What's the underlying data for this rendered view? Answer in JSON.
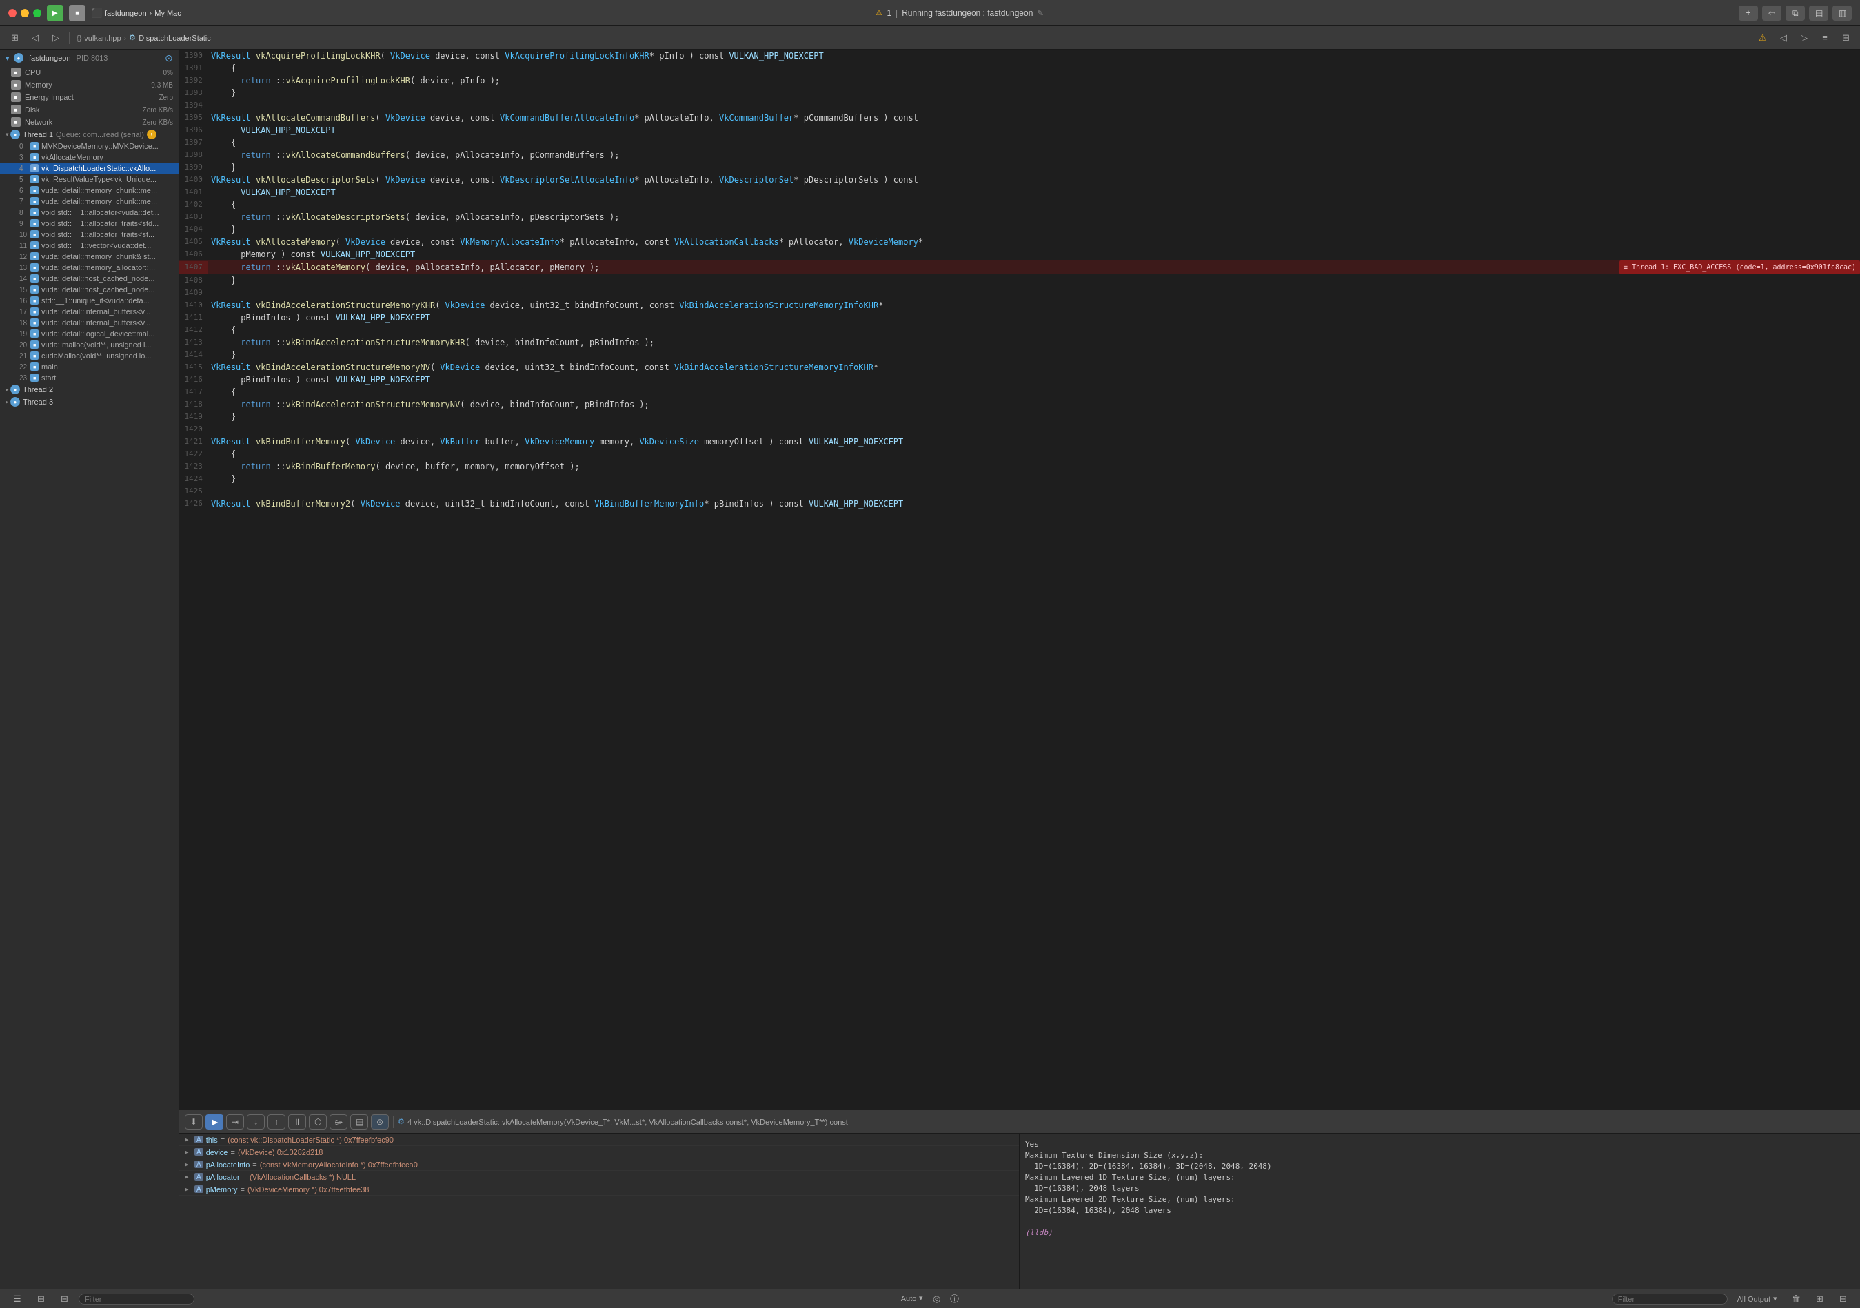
{
  "titlebar": {
    "app_name": "fastdungeon",
    "breadcrumb": [
      "fastdungeon",
      "My Mac"
    ],
    "status": "Running fastdungeon : fastdungeon",
    "warning": "1"
  },
  "toolbar_second": {
    "breadcrumb": [
      "vulkan.hpp",
      "DispatchLoaderStatic"
    ]
  },
  "sidebar": {
    "process": {
      "name": "fastdungeon",
      "pid_label": "PID 8013",
      "alert_icon": "●"
    },
    "metrics": [
      {
        "label": "CPU",
        "value": "0%"
      },
      {
        "label": "Memory",
        "value": "9.3 MB"
      },
      {
        "label": "Energy Impact",
        "value": "Zero"
      },
      {
        "label": "Disk",
        "value": "Zero KB/s"
      },
      {
        "label": "Network",
        "value": "Zero KB/s"
      }
    ],
    "threads": [
      {
        "id": "1",
        "label": "Thread 1",
        "queue": "Queue: com...read (serial)",
        "has_warning": true,
        "frames": [
          {
            "num": "0",
            "label": "MVKDeviceMemory::MVKDevice...",
            "has_pause": true
          },
          {
            "num": "3",
            "label": "vkAllocateMemory",
            "has_pause": true
          },
          {
            "num": "4",
            "label": "vk::DispatchLoaderStatic::vkAllo...",
            "selected": true,
            "has_pause": true
          },
          {
            "num": "5",
            "label": "vk::ResultValueType<vk::Unique...",
            "has_pause": true
          },
          {
            "num": "6",
            "label": "vuda::detail::memory_chunk::me...",
            "has_pause": true
          },
          {
            "num": "7",
            "label": "vuda::detail::memory_chunk::me...",
            "has_pause": true
          },
          {
            "num": "8",
            "label": "void std::__1::allocator<vuda::det...",
            "has_pause": true
          },
          {
            "num": "9",
            "label": "void std::__1::allocator_traits<std...",
            "has_pause": true
          },
          {
            "num": "10",
            "label": "void std::__1::allocator_traits<st...",
            "has_pause": true
          },
          {
            "num": "11",
            "label": "void std::__1::vector<vuda::det...",
            "has_pause": true
          },
          {
            "num": "12",
            "label": "vuda::detail::memory_chunk& st...",
            "has_pause": true
          },
          {
            "num": "13",
            "label": "vuda::detail::memory_allocator::...",
            "has_pause": true
          },
          {
            "num": "14",
            "label": "vuda::detail::host_cached_node...",
            "has_pause": true
          },
          {
            "num": "15",
            "label": "vuda::detail::host_cached_node...",
            "has_pause": true
          },
          {
            "num": "16",
            "label": "std::__1::unique_if<vuda::deta...",
            "has_pause": true
          },
          {
            "num": "17",
            "label": "vuda::detail::internal_buffers<v...",
            "has_pause": true
          },
          {
            "num": "18",
            "label": "vuda::detail::internal_buffers<v...",
            "has_pause": true
          },
          {
            "num": "19",
            "label": "vuda::detail::logical_device::mal...",
            "has_pause": true
          },
          {
            "num": "20",
            "label": "vuda::malloc(void**, unsigned l...",
            "has_pause": true
          },
          {
            "num": "21",
            "label": "cudaMalloc(void**, unsigned lo...",
            "has_pause": true
          },
          {
            "num": "22",
            "label": "main",
            "has_pause": true
          },
          {
            "num": "23",
            "label": "start",
            "has_pause": true
          }
        ]
      },
      {
        "id": "2",
        "label": "Thread 2",
        "frames": []
      },
      {
        "id": "3",
        "label": "Thread 3",
        "frames": []
      }
    ]
  },
  "editor": {
    "file_path": [
      "vulkan.hpp",
      "DispatchLoaderStatic"
    ],
    "lines": [
      {
        "num": "1390",
        "content": "    VkResult vkAcquireProfilingLockKHR( VkDevice device, const VkAcquireProfilingLockInfoKHR* pInfo ) const VULKAN_HPP_NOEXCEPT",
        "error": false
      },
      {
        "num": "1391",
        "content": "    {",
        "error": false
      },
      {
        "num": "1392",
        "content": "      return ::vkAcquireProfilingLockKHR( device, pInfo );",
        "error": false
      },
      {
        "num": "1393",
        "content": "    }",
        "error": false
      },
      {
        "num": "1394",
        "content": "",
        "error": false
      },
      {
        "num": "1395",
        "content": "    VkResult vkAllocateCommandBuffers( VkDevice device, const VkCommandBufferAllocateInfo* pAllocateInfo, VkCommandBuffer* pCommandBuffers ) const",
        "error": false
      },
      {
        "num": "1396",
        "content": "      VULKAN_HPP_NOEXCEPT",
        "error": false
      },
      {
        "num": "1397",
        "content": "    {",
        "error": false
      },
      {
        "num": "1398",
        "content": "      return ::vkAllocateCommandBuffers( device, pAllocateInfo, pCommandBuffers );",
        "error": false
      },
      {
        "num": "1399",
        "content": "    }",
        "error": false
      },
      {
        "num": "1400",
        "content": "    VkResult vkAllocateDescriptorSets( VkDevice device, const VkDescriptorSetAllocateInfo* pAllocateInfo, VkDescriptorSet* pDescriptorSets ) const",
        "error": false
      },
      {
        "num": "1401",
        "content": "      VULKAN_HPP_NOEXCEPT",
        "error": false
      },
      {
        "num": "1402",
        "content": "    {",
        "error": false
      },
      {
        "num": "1403",
        "content": "      return ::vkAllocateDescriptorSets( device, pAllocateInfo, pDescriptorSets );",
        "error": false
      },
      {
        "num": "1404",
        "content": "    }",
        "error": false
      },
      {
        "num": "1405",
        "content": "    VkResult vkAllocateMemory( VkDevice device, const VkMemoryAllocateInfo* pAllocateInfo, const VkAllocationCallbacks* pAllocator, VkDeviceMemory*",
        "error": false
      },
      {
        "num": "1406",
        "content": "      pMemory ) const VULKAN_HPP_NOEXCEPT",
        "error": false
      },
      {
        "num": "1407",
        "content": "      return ::vkAllocateMemory( device, pAllocateInfo, pAllocator, pMemory );",
        "error": true,
        "error_msg": "Thread 1: EXC_BAD_ACCESS (code=1, address=0x901fc8cac)"
      },
      {
        "num": "1408",
        "content": "    }",
        "error": false
      },
      {
        "num": "1409",
        "content": "",
        "error": false
      },
      {
        "num": "1410",
        "content": "    VkResult vkBindAccelerationStructureMemoryKHR( VkDevice device, uint32_t bindInfoCount, const VkBindAccelerationStructureMemoryInfoKHR*",
        "error": false
      },
      {
        "num": "1411",
        "content": "      pBindInfos ) const VULKAN_HPP_NOEXCEPT",
        "error": false
      },
      {
        "num": "1412",
        "content": "    {",
        "error": false
      },
      {
        "num": "1413",
        "content": "      return ::vkBindAccelerationStructureMemoryKHR( device, bindInfoCount, pBindInfos );",
        "error": false
      },
      {
        "num": "1414",
        "content": "    }",
        "error": false
      },
      {
        "num": "1415",
        "content": "    VkResult vkBindAccelerationStructureMemoryNV( VkDevice device, uint32_t bindInfoCount, const VkBindAccelerationStructureMemoryInfoKHR*",
        "error": false
      },
      {
        "num": "1416",
        "content": "      pBindInfos ) const VULKAN_HPP_NOEXCEPT",
        "error": false
      },
      {
        "num": "1417",
        "content": "    {",
        "error": false
      },
      {
        "num": "1418",
        "content": "      return ::vkBindAccelerationStructureMemoryNV( device, bindInfoCount, pBindInfos );",
        "error": false
      },
      {
        "num": "1419",
        "content": "    }",
        "error": false
      },
      {
        "num": "1420",
        "content": "",
        "error": false
      },
      {
        "num": "1421",
        "content": "    VkResult vkBindBufferMemory( VkDevice device, VkBuffer buffer, VkDeviceMemory memory, VkDeviceSize memoryOffset ) const VULKAN_HPP_NOEXCEPT",
        "error": false
      },
      {
        "num": "1422",
        "content": "    {",
        "error": false
      },
      {
        "num": "1423",
        "content": "      return ::vkBindBufferMemory( device, buffer, memory, memoryOffset );",
        "error": false
      },
      {
        "num": "1424",
        "content": "    }",
        "error": false
      },
      {
        "num": "1425",
        "content": "",
        "error": false
      },
      {
        "num": "1426",
        "content": "    VkResult vkBindBufferMemory2( VkDevice device, uint32_t bindInfoCount, const VkBindBufferMemoryInfo* pBindInfos ) const VULKAN_HPP_NOEXCEPT",
        "error": false
      }
    ]
  },
  "debug_bar": {
    "location": "4 vk::DispatchLoaderStatic::vkAllocateMemory(VkDevice_T*, VkM...st*, VkAllocationCallbacks const*, VkDeviceMemory_T**) const"
  },
  "variables": [
    {
      "name": "this",
      "value": "= (const vk::DispatchLoaderStatic *) 0x7ffeefbfec90",
      "type": "A"
    },
    {
      "name": "device",
      "value": "= (VkDevice) 0x10282d218",
      "type": "A"
    },
    {
      "name": "pAllocateInfo",
      "value": "= (const VkMemoryAllocateInfo *) 0x7ffeefbfeca0",
      "type": "A"
    },
    {
      "name": "pAllocator",
      "value": "= (VkAllocationCallbacks *) NULL",
      "type": "A"
    },
    {
      "name": "pMemory",
      "value": "= (VkDeviceMemory *) 0x7ffeefbfee38",
      "type": "A"
    }
  ],
  "output_panel": {
    "content": "Yes\nMaximum Texture Dimension Size (x,y,z):\n  1D=(16384), 2D=(16384, 16384), 3D=(2048, 2048, 2048)\nMaximum Layered 1D Texture Size, (num) layers:\n  1D=(16384), 2048 layers\nMaximum Layered 2D Texture Size, (num) layers:\n  2D=(16384, 16384), 2048 layers",
    "lldb_label": "(lldb)",
    "output_label": "All Output"
  },
  "status_bar": {
    "filter_placeholder": "Filter",
    "auto_label": "Auto",
    "output_label": "All Output",
    "filter_placeholder2": "Filter"
  }
}
